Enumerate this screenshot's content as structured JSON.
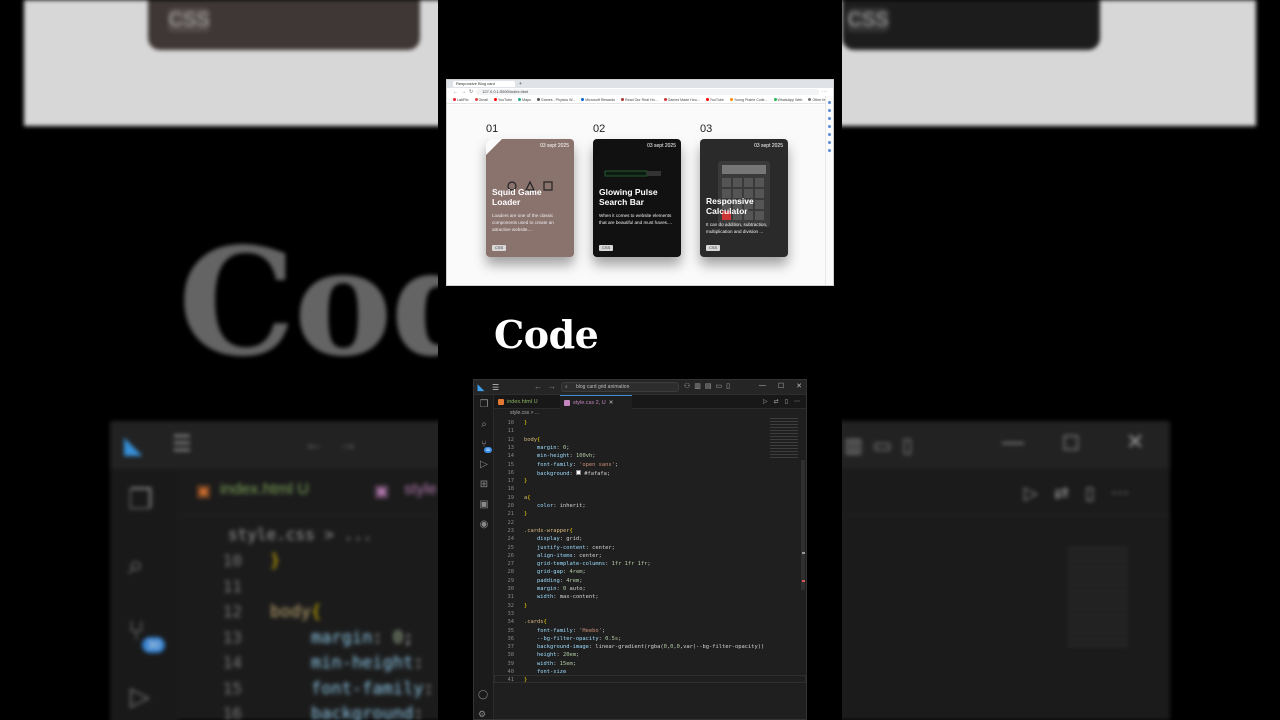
{
  "background": {
    "badge_left": "CSS",
    "badge_right": "CSS",
    "code_word": "Code",
    "tabs": {
      "html": "index.html U",
      "css": "style"
    },
    "breadcrumb": "style.css > ...",
    "badge_count": "30",
    "lines": [
      {
        "n": "10",
        "t": "}"
      },
      {
        "n": "11",
        "t": ""
      },
      {
        "n": "12",
        "t": "body{"
      },
      {
        "n": "13",
        "t": "    margin: 0;"
      },
      {
        "n": "14",
        "t": "    min-height:"
      },
      {
        "n": "15",
        "t": "    font-family:"
      },
      {
        "n": "16",
        "t": "    background:"
      }
    ]
  },
  "browser": {
    "tab_title": "Responsive Blog card",
    "url": "127.0.0.1:5500/index.html",
    "bookmarks": [
      "LabFlix",
      "Gmail",
      "YouTube",
      "Maps",
      "Games - Physics W...",
      "Microsoft Rewards",
      "Read Our Real Ho...",
      "Games Made Hou...",
      "YouTube",
      "Young Prairie Colle...",
      "WhatsApp Web",
      "Other favorites"
    ],
    "cards": [
      {
        "number": "01",
        "date": "03 sept 2025",
        "title": "Squid Game Loader",
        "desc": "Loaders are one of the classic components used to create an attractive website....",
        "badge": "CSS",
        "bg": "#8a726d"
      },
      {
        "number": "02",
        "date": "03 sept 2025",
        "title": "Glowing Pulse Search Bar",
        "desc": "When it comes to website elements that are beautiful and must haves....",
        "badge": "CSS",
        "bg": "#111111"
      },
      {
        "number": "03",
        "date": "03 sept 2025",
        "title": "Responsive Calculator",
        "desc": "It can do addition, subtraction, multiplication and division ...",
        "badge": "CSS",
        "bg": "#2a2a2a"
      }
    ]
  },
  "heading": "Code",
  "vscode": {
    "search": "blog card grid animation",
    "tabs": [
      {
        "label": "index.html U",
        "color": "#e37933"
      },
      {
        "label": "style.css 2, U",
        "color": "#c586c0"
      }
    ],
    "breadcrumb": "style.css > ...",
    "badge_count": "30",
    "lines": [
      {
        "n": "10",
        "t": "}"
      },
      {
        "n": "11",
        "t": ""
      },
      {
        "n": "12",
        "t": "body{"
      },
      {
        "n": "13",
        "t": "    margin: 0;"
      },
      {
        "n": "14",
        "t": "    min-height: 100vh;"
      },
      {
        "n": "15",
        "t": "    font-family: 'open sans';"
      },
      {
        "n": "16",
        "t": "    background: ■#fafafa;"
      },
      {
        "n": "17",
        "t": "}"
      },
      {
        "n": "18",
        "t": ""
      },
      {
        "n": "19",
        "t": "a{"
      },
      {
        "n": "20",
        "t": "    color: inherit;"
      },
      {
        "n": "21",
        "t": "}"
      },
      {
        "n": "22",
        "t": ""
      },
      {
        "n": "23",
        "t": ".cards-wrapper{"
      },
      {
        "n": "24",
        "t": "    display: grid;"
      },
      {
        "n": "25",
        "t": "    justify-content: center;"
      },
      {
        "n": "26",
        "t": "    align-items: center;"
      },
      {
        "n": "27",
        "t": "    grid-template-columns: 1fr 1fr 1fr;"
      },
      {
        "n": "28",
        "t": "    grid-gap: 4rem;"
      },
      {
        "n": "29",
        "t": "    padding: 4rem;"
      },
      {
        "n": "30",
        "t": "    margin: 0 auto;"
      },
      {
        "n": "31",
        "t": "    width: max-content;"
      },
      {
        "n": "32",
        "t": "}"
      },
      {
        "n": "33",
        "t": ""
      },
      {
        "n": "34",
        "t": ".cards{"
      },
      {
        "n": "35",
        "t": "    font-family: 'Heebo';"
      },
      {
        "n": "36",
        "t": "    --bg-filter-opacity: 0.5s;"
      },
      {
        "n": "37",
        "t": "    background-image: linear-gradient(rgba(0,0,0,var(--bg-filter-opacity))"
      },
      {
        "n": "38",
        "t": "    height: 20em;"
      },
      {
        "n": "39",
        "t": "    width: 15em;"
      },
      {
        "n": "40",
        "t": "    font-size"
      },
      {
        "n": "41",
        "t": "}"
      }
    ]
  }
}
